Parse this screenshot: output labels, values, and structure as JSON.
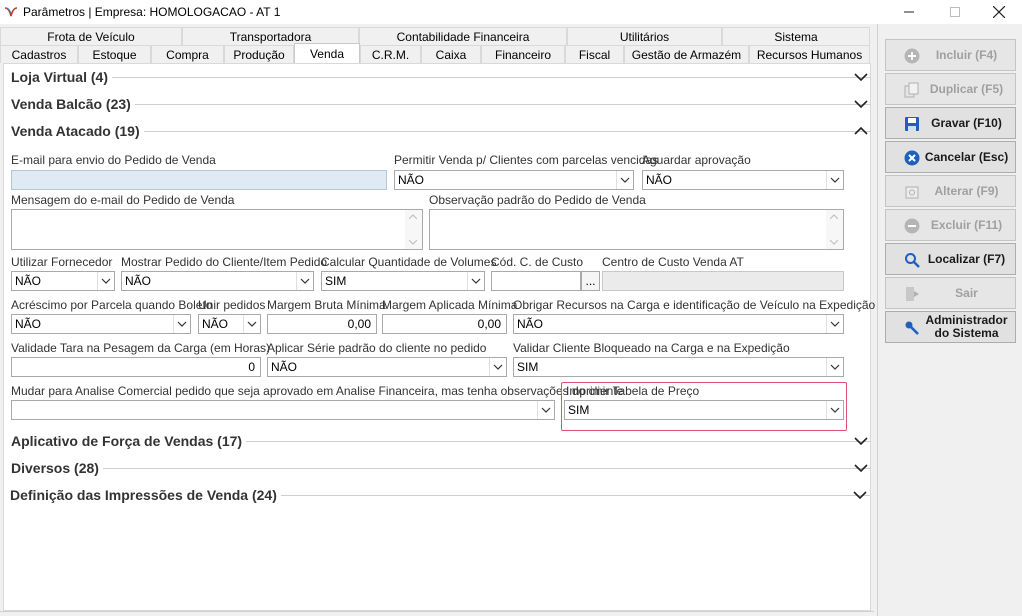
{
  "window": {
    "title": "Parâmetros | Empresa: HOMOLOGACAO - AT 1",
    "controls": {
      "minimize": "—",
      "maximize": "☐",
      "close": "✕"
    }
  },
  "tabs": {
    "row1": [
      "Frota de Veículo",
      "Transportadora",
      "Contabilidade Financeira",
      "Utilitários",
      "Sistema"
    ],
    "row2": [
      "Cadastros",
      "Estoque",
      "Compra",
      "Produção",
      "Venda",
      "C.R.M.",
      "Caixa",
      "Financeiro",
      "Fiscal",
      "Gestão de Armazém",
      "Recursos Humanos"
    ],
    "active": "Venda"
  },
  "groups": {
    "loja_virtual": "Loja Virtual (4)",
    "venda_balcao": "Venda Balcão (23)",
    "venda_atacado": "Venda Atacado (19)",
    "aplicativo": "Aplicativo de Força de Vendas (17)",
    "diversos": "Diversos (28)",
    "impressoes": "Definição das Impressões de Venda (24)"
  },
  "form": {
    "email_pedido": {
      "label": "E-mail para envio do Pedido de Venda",
      "value": ""
    },
    "permitir_venda": {
      "label": "Permitir Venda p/ Clientes com parcelas vencidas",
      "value": "NÃO"
    },
    "aguardar_aprovacao": {
      "label": "Aguardar aprovação",
      "value": "NÃO"
    },
    "mensagem_email": {
      "label": "Mensagem do e-mail do Pedido de Venda",
      "value": ""
    },
    "observacao_padrao": {
      "label": "Observação padrão do Pedido de Venda",
      "value": ""
    },
    "utilizar_fornecedor": {
      "label": "Utilizar Fornecedor",
      "value": "NÃO"
    },
    "mostrar_pedido": {
      "label": "Mostrar Pedido do Cliente/Item Pedido",
      "value": "NÃO"
    },
    "calcular_quantidade": {
      "label": "Calcular Quantidade de Volumes",
      "value": "SIM"
    },
    "cod_centro_custo": {
      "label": "Cód. C. de Custo",
      "value": "",
      "button": "..."
    },
    "centro_custo_venda": {
      "label": "Centro de Custo Venda AT",
      "value": ""
    },
    "acrescimo_parcela": {
      "label": "Acréscimo por Parcela quando Boleto",
      "value": "NÃO"
    },
    "unir_pedidos": {
      "label": "Unir pedidos",
      "value": "NÃO"
    },
    "margem_bruta": {
      "label": "Margem Bruta Mínima",
      "value": "0,00"
    },
    "margem_aplicada": {
      "label": "Margem Aplicada Mínima",
      "value": "0,00"
    },
    "obrigar_recursos": {
      "label": "Obrigar Recursos na Carga e identificação de Veículo na Expedição",
      "value": "NÃO"
    },
    "validade_tara": {
      "label": "Validade Tara na Pesagem da Carga (em Horas)",
      "value": "0"
    },
    "aplicar_serie": {
      "label": "Aplicar Série padrão do cliente no pedido",
      "value": "NÃO"
    },
    "validar_cliente": {
      "label": "Validar Cliente Bloqueado na Carga e na Expedição",
      "value": "SIM"
    },
    "mudar_analise": {
      "label": "Mudar para Analise Comercial pedido que seja aprovado em Analise Financeira, mas tenha observações do cliente",
      "value": ""
    },
    "imprimir_tabela": {
      "label": "Imprimir Tabela de Preço",
      "value": "SIM"
    }
  },
  "toolbar": {
    "incluir": "Incluir (F4)",
    "duplicar": "Duplicar (F5)",
    "gravar": "Gravar (F10)",
    "cancelar": "Cancelar (Esc)",
    "alterar": "Alterar (F9)",
    "excluir": "Excluir (F11)",
    "localizar": "Localizar (F7)",
    "sair": "Sair",
    "administrador_l1": "Administrador",
    "administrador_l2": "do Sistema"
  },
  "colors": {
    "highlight": "#e0526f",
    "accent": "#1f5fbf",
    "disabled": "#a0a0a0"
  },
  "icons": [
    "app-logo-icon",
    "chevron-down-icon",
    "chevron-up-icon",
    "plus-circle-icon",
    "duplicate-icon",
    "save-icon",
    "cancel-circle-icon",
    "edit-icon",
    "minus-circle-icon",
    "search-icon",
    "exit-icon",
    "wrench-icon"
  ]
}
